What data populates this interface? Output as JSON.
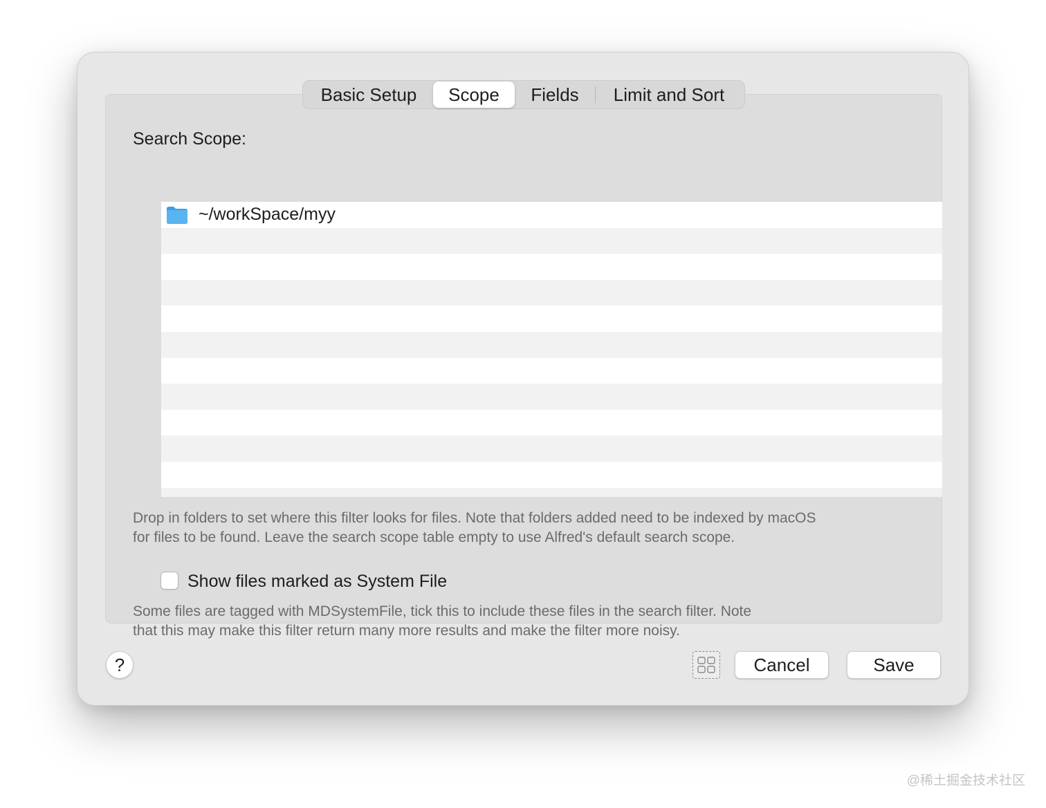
{
  "tabs": [
    {
      "label": "Basic Setup",
      "active": false
    },
    {
      "label": "Scope",
      "active": true
    },
    {
      "label": "Fields",
      "active": false
    },
    {
      "label": "Limit and Sort",
      "active": false
    }
  ],
  "scope": {
    "title": "Search Scope:",
    "folder_icon": "folder-icon",
    "items": [
      "~/workSpace/myy"
    ],
    "help_line1": "Drop in folders to set where this filter looks for files. Note that folders added need to be indexed by macOS",
    "help_line2": "for files to be found. Leave the search scope table empty to use Alfred's default search scope."
  },
  "system_file": {
    "checked": false,
    "label": "Show files marked as System File",
    "help_line1": "Some files are tagged with MDSystemFile, tick this to include these files in the search filter. Note",
    "help_line2": "that this may make this filter return many more results and make the filter more noisy."
  },
  "footer": {
    "help_label": "?",
    "grid_icon": "grid-icon",
    "cancel_label": "Cancel",
    "save_label": "Save"
  },
  "watermark": "@稀土掘金技术社区",
  "colors": {
    "folder": "#5ab4f0",
    "dialog_bg": "#e7e7e7",
    "panel_bg": "#dddddd",
    "row_alt": "#f2f2f2"
  }
}
